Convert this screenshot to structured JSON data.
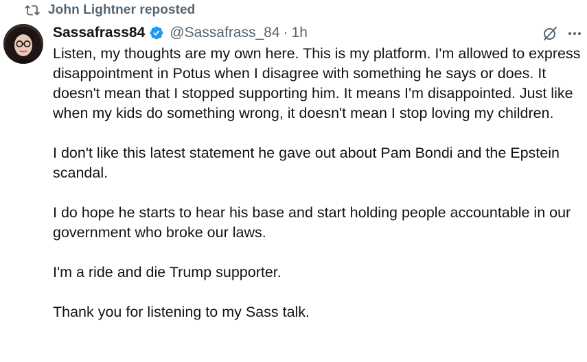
{
  "repost": {
    "label": "John Lightner reposted",
    "icon": "repost-icon"
  },
  "author": {
    "display_name": "Sassafrass84",
    "verified": true,
    "handle": "@Sassafrass_84",
    "separator": "·",
    "time": "1h"
  },
  "actions": {
    "grok_icon": "grok-icon",
    "more_icon": "more-icon"
  },
  "tweet": {
    "paragraphs": [
      "Listen, my thoughts are my own here. This is my platform. I'm allowed to express disappointment in Potus when I disagree with something he says or does. It doesn't mean that I stopped supporting him. It means I'm disappointed. Just like when my kids do something wrong, it doesn't mean I stop loving my children.",
      "I don't like this latest statement he gave out about Pam Bondi and the Epstein scandal.",
      "I do hope he starts to hear his base and start holding people accountable in our government who broke our laws.",
      "I'm a ride and die Trump supporter.",
      "Thank you for listening to my Sass talk."
    ]
  },
  "colors": {
    "text_primary": "#0f1419",
    "text_secondary": "#536471",
    "verified_blue": "#1d9bf0"
  }
}
